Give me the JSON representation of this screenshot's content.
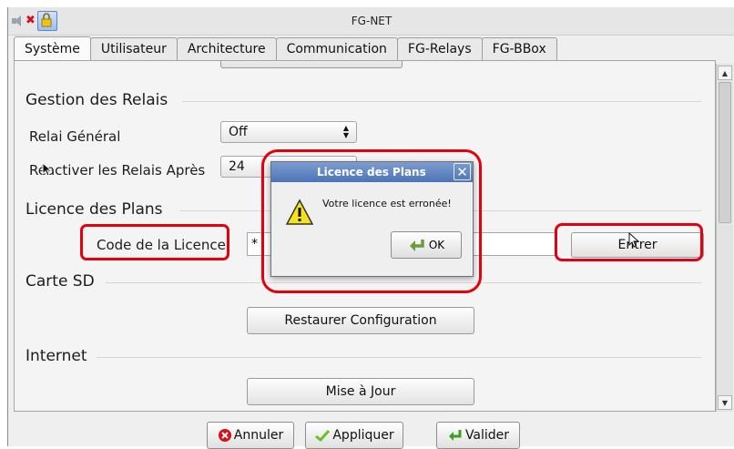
{
  "window": {
    "title": "FG-NET"
  },
  "titlebar_icons": [
    "speaker-icon",
    "close-x-icon",
    "lock-icon"
  ],
  "tabs": [
    {
      "label": "Système",
      "active": true
    },
    {
      "label": "Utilisateur",
      "active": false
    },
    {
      "label": "Architecture",
      "active": false
    },
    {
      "label": "Communication",
      "active": false
    },
    {
      "label": "FG-Relays",
      "active": false
    },
    {
      "label": "FG-BBox",
      "active": false
    }
  ],
  "relais": {
    "heading": "Gestion des Relais",
    "general_label": "Relai Général",
    "general_value": "Off",
    "reactiver_label": "Réactiver les Relais Après",
    "reactiver_value": "24"
  },
  "licence": {
    "heading": "Licence des Plans",
    "code_label": "Code de la Licence",
    "code_value": "*",
    "enter_button": "Entrer"
  },
  "carte_sd": {
    "heading": "Carte SD",
    "restore_button": "Restaurer Configuration"
  },
  "internet": {
    "heading": "Internet",
    "update_button": "Mise à Jour"
  },
  "bottom": {
    "cancel": "Annuler",
    "apply": "Appliquer",
    "validate": "Valider"
  },
  "dialog": {
    "title": "Licence des Plans",
    "close": "✕",
    "message": "Votre licence est erronée!",
    "ok": "OK"
  },
  "colors": {
    "highlight": "#e4000f",
    "dialog_title": "#4d74b8",
    "cancel_icon": "#d4111b",
    "apply_icon": "#6bbf2a",
    "validate_icon": "#3aa020"
  }
}
